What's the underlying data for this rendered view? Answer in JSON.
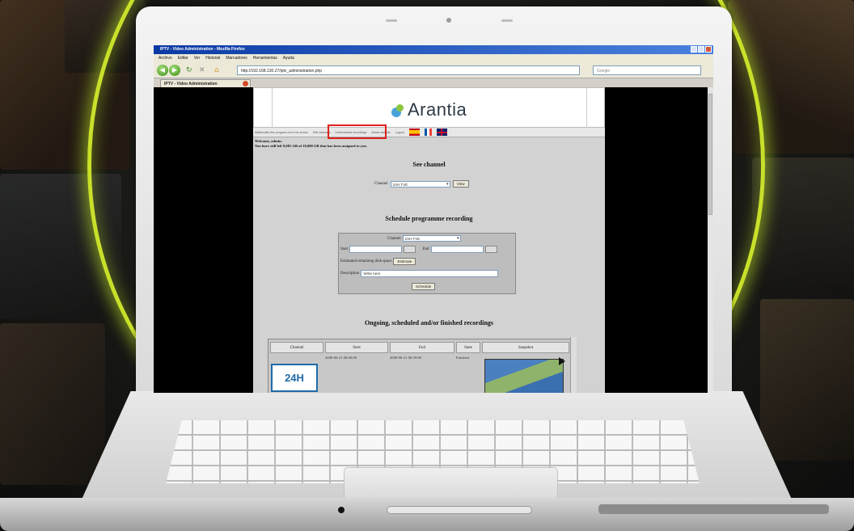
{
  "browser": {
    "window_title": "IPTV - Video Administration - Mozilla Firefox",
    "menu": [
      "Archivo",
      "Editar",
      "Ver",
      "Historial",
      "Marcadores",
      "Herramientas",
      "Ayuda"
    ],
    "url": "http://192.168.130.27/iptv_administration.php",
    "search_placeholder": "Google",
    "tab_title": "IPTV - Video Administration"
  },
  "page": {
    "logo_text": "Arantia",
    "links": [
      "Add/modify free program not to be shown",
      "Edit channels",
      "List/schedule recordings",
      "Admin website",
      "Logout"
    ],
    "welcome_line1": "Welcome, admin.",
    "welcome_line2": "You have still left 9,081 GB of 10,000 GB that has been assigned to you.",
    "see_channel": {
      "heading": "See channel",
      "label": "Channel",
      "selected": "24H TVE",
      "button": "View"
    },
    "schedule": {
      "heading": "Schedule programme recording",
      "channel_label": "Channel",
      "channel_selected": "24H TVE",
      "start_label": "Start",
      "end_label": "End",
      "estimate_label": "Estimated remaining disk space",
      "estimate_button": "Estimate",
      "description_label": "Description",
      "description_value": "Write here",
      "submit_button": "Schedule"
    },
    "recordings": {
      "heading": "Ongoing, scheduled and/or finished recordings",
      "columns": [
        "Channel",
        "Start",
        "End",
        "State",
        "Snapshot"
      ],
      "rows": [
        {
          "channel_logo": "24H",
          "start": "2008-06-21 08:00:00",
          "end": "2008-06-21 08:59:00",
          "state": "Finished"
        }
      ]
    }
  }
}
